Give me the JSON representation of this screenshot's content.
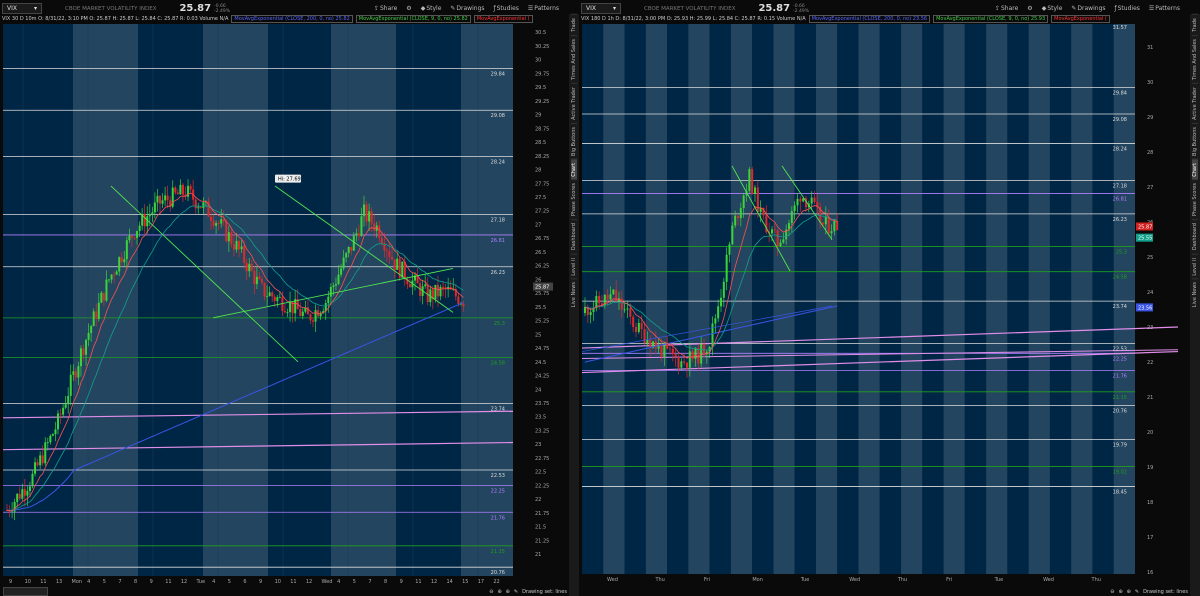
{
  "colors": {
    "shade": "#002645",
    "light": "#23455f",
    "up": "#3cd23c",
    "down": "#e12828",
    "ma_blue": "#3a55e6",
    "ma_green": "#12a08c",
    "ma_red": "#ff5050",
    "white_line": "#dcdcdc",
    "pink_line": "#e08ee8",
    "green_line": "#1ea01e",
    "trend": "#50e650",
    "purple_line": "#b080ff"
  },
  "left": {
    "symbol": "VIX",
    "description": "CBOE MARKET VOLATILITY INDEX",
    "last": "25.87",
    "change": "-0.66",
    "change_pct": "-2.49%",
    "info": "VIX 30 D 10m  O: 8/31/22, 3:10 PM  O: 25.87  H: 25.87  L: 25.84  C: 25.87  R: 0.03  Volume  N/A",
    "ma1": "MovAvgExponential (CLOSE, 200, 0, no) 25.82",
    "ma2": "MovAvgExponential (CLOSE, 9, 0, no) 25.82",
    "ma3": "MovAvgExponential (",
    "toolbar": {
      "share": "Share",
      "style": "Style",
      "drawings": "Drawings",
      "studies": "Studies",
      "patterns": "Patterns"
    },
    "hi_label": "Hi: 27.69",
    "last_tag": "25.87",
    "yticks": [
      "30.5",
      "30.25",
      "30",
      "29.75",
      "29.5",
      "29.25",
      "29",
      "28.75",
      "28.5",
      "28.25",
      "28",
      "27.75",
      "27.5",
      "27.25",
      "27",
      "26.75",
      "26.5",
      "26.25",
      "26",
      "25.75",
      "25.5",
      "25.25",
      "25",
      "24.75",
      "24.5",
      "24.25",
      "24",
      "23.75",
      "23.5",
      "23.25",
      "23",
      "22.75",
      "22.5",
      "22.25",
      "22",
      "21.75",
      "21.5",
      "21.25",
      "21"
    ],
    "levels": [
      {
        "label": "29.84",
        "kind": "white"
      },
      {
        "label": "29.08",
        "kind": "white"
      },
      {
        "label": "28.24",
        "kind": "white"
      },
      {
        "label": "27.18",
        "kind": "white"
      },
      {
        "label": "26.81",
        "kind": "purple"
      },
      {
        "label": "26.23",
        "kind": "white"
      },
      {
        "label": "25.3",
        "kind": "green"
      },
      {
        "label": "24.58",
        "kind": "green"
      },
      {
        "label": "23.74",
        "kind": "white"
      },
      {
        "label": "22.53",
        "kind": "white"
      },
      {
        "label": "22.25",
        "kind": "purple"
      },
      {
        "label": "21.76",
        "kind": "purple"
      },
      {
        "label": "21.15",
        "kind": "green"
      },
      {
        "label": "20.76",
        "kind": "white"
      }
    ],
    "xlabels": [
      "9",
      "10",
      "11",
      "13",
      "Mon",
      "4",
      "5",
      "7",
      "8",
      "9",
      "11",
      "12",
      "Tue",
      "4",
      "5",
      "6",
      "9",
      "10",
      "11",
      "12",
      "Wed",
      "4",
      "5",
      "7",
      "8",
      "9",
      "11",
      "12",
      "14",
      "15",
      "17",
      "22"
    ],
    "vtabs": [
      "Trade",
      "Times And Sales",
      "Active Trader",
      "Big Buttons",
      "Chart",
      "Phase Scores",
      "Dashboard",
      "Level II",
      "Live News"
    ],
    "active_tab": "Chart",
    "drawing_set": "Drawing set: lines"
  },
  "right": {
    "symbol": "VIX",
    "description": "CBOE MARKET VOLATILITY INDEX",
    "last": "25.87",
    "change": "-0.66",
    "change_pct": "-2.49%",
    "info": "VIX 180 D 1h  D: 8/31/22, 3:00 PM  O: 25.93  H: 25.99  L: 25.84  C: 25.87  R: 0.15  Volume  N/A",
    "ma1": "MovAvgExponential (CLOSE, 200, 0, no) 23.56",
    "ma2": "MovAvgExponential (CLOSE, 9, 0, no) 25.93",
    "ma3": "MovAvgExponential (",
    "toolbar": {
      "share": "Share",
      "style": "Style",
      "drawings": "Drawings",
      "studies": "Studies",
      "patterns": "Patterns"
    },
    "yticks": [
      "31",
      "30",
      "29",
      "28",
      "27",
      "26",
      "25",
      "24",
      "23",
      "22",
      "21",
      "20",
      "19",
      "18",
      "17",
      "16"
    ],
    "top_label": "31.57",
    "levels": [
      {
        "label": "29.84",
        "kind": "white"
      },
      {
        "label": "29.08",
        "kind": "white"
      },
      {
        "label": "28.24",
        "kind": "white"
      },
      {
        "label": "27.18",
        "kind": "white"
      },
      {
        "label": "26.81",
        "kind": "purple"
      },
      {
        "label": "26.23",
        "kind": "white"
      },
      {
        "label": "25.3",
        "kind": "green"
      },
      {
        "label": "24.58",
        "kind": "green"
      },
      {
        "label": "23.74",
        "kind": "white"
      },
      {
        "label": "22.53",
        "kind": "white"
      },
      {
        "label": "22.25",
        "kind": "purple"
      },
      {
        "label": "21.76",
        "kind": "purple"
      },
      {
        "label": "21.15",
        "kind": "green"
      },
      {
        "label": "20.76",
        "kind": "white"
      },
      {
        "label": "19.79",
        "kind": "white"
      },
      {
        "label": "19.02",
        "kind": "green"
      },
      {
        "label": "18.45",
        "kind": "white"
      }
    ],
    "tags": [
      {
        "label": "25.87",
        "color": "#d02020"
      },
      {
        "label": "25.55",
        "color": "#12a08c"
      },
      {
        "label": "23.56",
        "color": "#3a55e6"
      }
    ],
    "xlabels": [
      "Wed",
      "Thu",
      "Fri",
      "Mon",
      "Tue",
      "Wed",
      "Thu",
      "Fri",
      "Tue",
      "Wed",
      "Thu"
    ],
    "vtabs": [
      "Trade",
      "Times And Sales",
      "Active Trader",
      "Big Buttons",
      "Chart",
      "Phase Scores",
      "Dashboard",
      "Level II",
      "Live News"
    ],
    "active_tab": "Chart",
    "drawing_set": "Drawing set: lines"
  }
}
